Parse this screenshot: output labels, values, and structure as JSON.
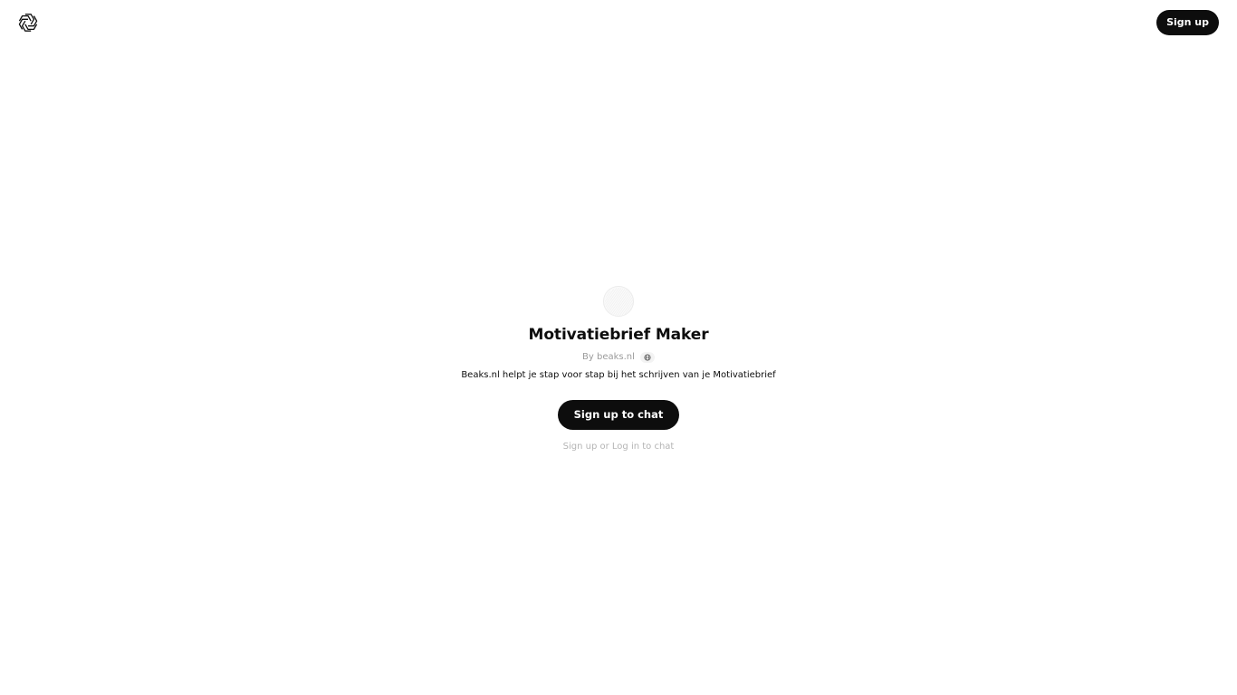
{
  "header": {
    "logo_icon": "openai-logo-icon",
    "signup_label": "Sign up"
  },
  "gpt": {
    "avatar_icon": "gpt-avatar-icon",
    "title": "Motivatiebrief Maker",
    "author": "By beaks.nl",
    "author_badge_icon": "globe-icon",
    "description": "Beaks.nl helpt je stap voor stap bij het schrijven van je Motivatiebrief"
  },
  "actions": {
    "chat_button_label": "Sign up to chat",
    "login_hint": "Sign up or Log in to chat"
  },
  "colors": {
    "primary_button": "#0d0d0d",
    "button_text": "#ffffff",
    "muted_text": "#9b9b9b",
    "hint_text": "#b4b4b4"
  }
}
